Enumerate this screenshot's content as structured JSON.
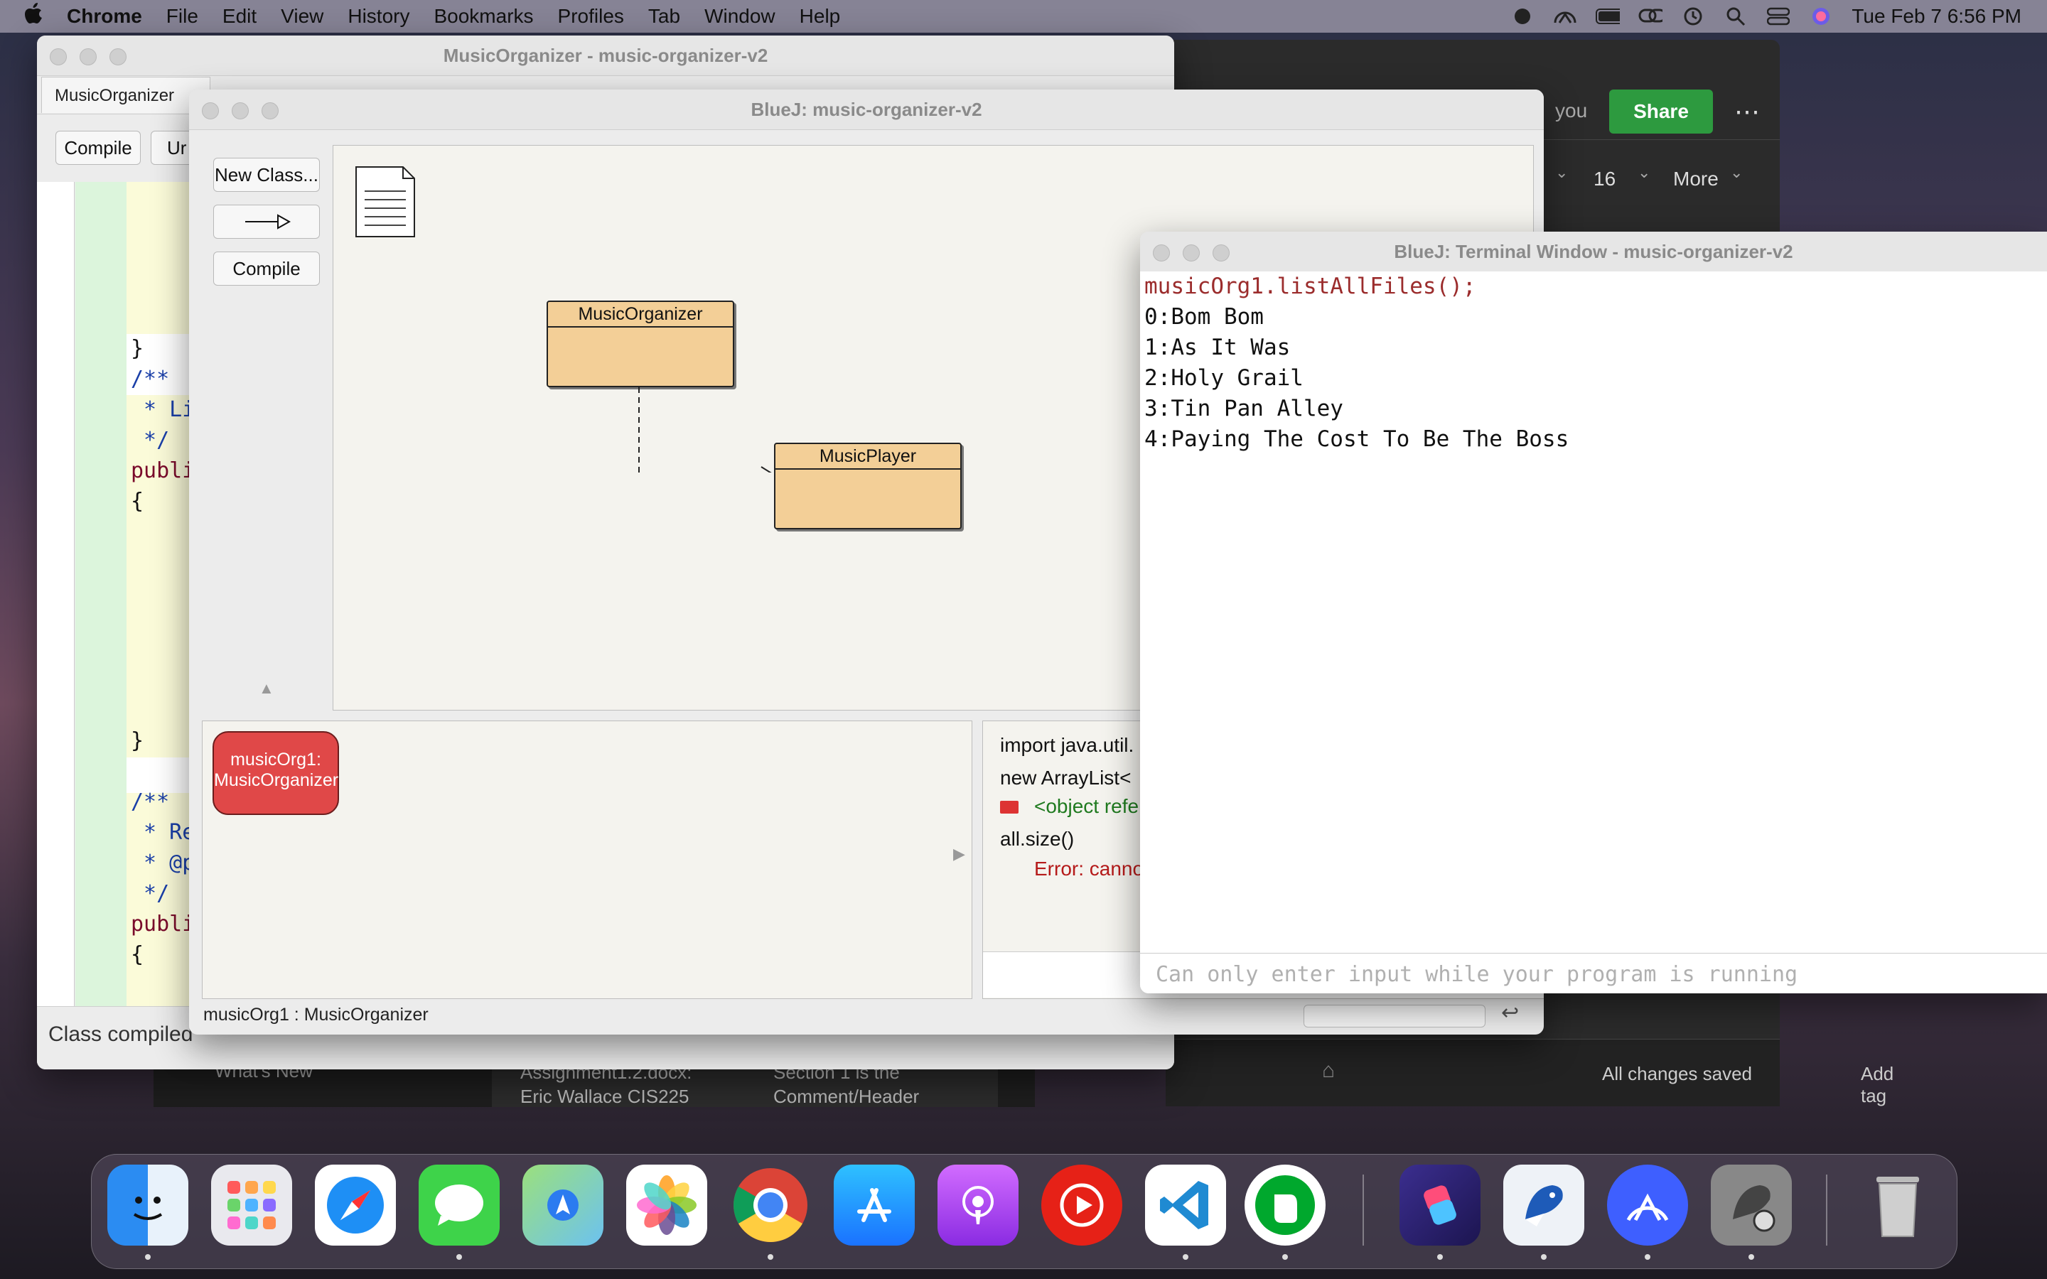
{
  "menubar": {
    "app_name": "Chrome",
    "items": [
      "File",
      "Edit",
      "View",
      "History",
      "Bookmarks",
      "Profiles",
      "Tab",
      "Window",
      "Help"
    ],
    "datetime": "Tue Feb 7  6:56 PM"
  },
  "chrome_bg": {
    "share_label": "Share",
    "more_dots": "⋯",
    "partial_text": "you",
    "font_size": "16",
    "more_label": "More",
    "add_tag": "Add tag",
    "status": "All changes saved",
    "tabs": [
      "What's New",
      "Assignment1.2.docx: Eric Wallace CIS225",
      "Section 1 is the Comment/Header"
    ]
  },
  "editor": {
    "title": "MusicOrganizer - music-organizer-v2",
    "tab_label": "MusicOrganizer",
    "compile_label": "Compile",
    "undo_partial": "Ur",
    "status": "Class compiled",
    "code_lines": [
      "}",
      "",
      "/**",
      " * Li",
      " */",
      "publi",
      "{",
      "",
      "",
      "",
      "",
      "",
      "}",
      "",
      "/**",
      " * Re",
      " * @p",
      " */",
      "publi",
      "{"
    ]
  },
  "bluej": {
    "title": "BlueJ:  music-organizer-v2",
    "new_class_label": "New Class...",
    "arrow_label": "→",
    "compile_label": "Compile",
    "classes": [
      {
        "name": "MusicOrganizer"
      },
      {
        "name": "MusicPlayer"
      }
    ],
    "object": {
      "line1": "musicOrg1:",
      "line2": "MusicOrganizer"
    },
    "status": "musicOrg1 : MusicOrganizer",
    "codepad": {
      "line1": "import java.util.",
      "line2": "new ArrayList<",
      "line3": "<object refe",
      "line4": "all.size()",
      "line5": "Error: canno"
    }
  },
  "terminal": {
    "title": "BlueJ: Terminal Window - music-organizer-v2",
    "command": "musicOrg1.listAllFiles();",
    "lines": [
      "0:Bom Bom",
      "1:As It Was",
      "2:Holy Grail",
      "3:Tin Pan Alley",
      "4:Paying The Cost To Be The Boss"
    ],
    "input_placeholder": "Can only enter input while your program is running"
  },
  "dock": {
    "apps": [
      "Finder",
      "Launchpad",
      "Safari",
      "Messages",
      "Maps",
      "Photos",
      "Chrome",
      "App Store",
      "Podcasts",
      "YouTube",
      "VS Code",
      "Evernote",
      "Shortcuts",
      "BlueJ",
      "NordVPN",
      "BlueJ Settings",
      "Trash"
    ]
  },
  "colors": {
    "command_red": "#9b2c2c",
    "share_green": "#2d9a3f",
    "object_red": "#e04848",
    "class_fill": "#f3cf97"
  }
}
